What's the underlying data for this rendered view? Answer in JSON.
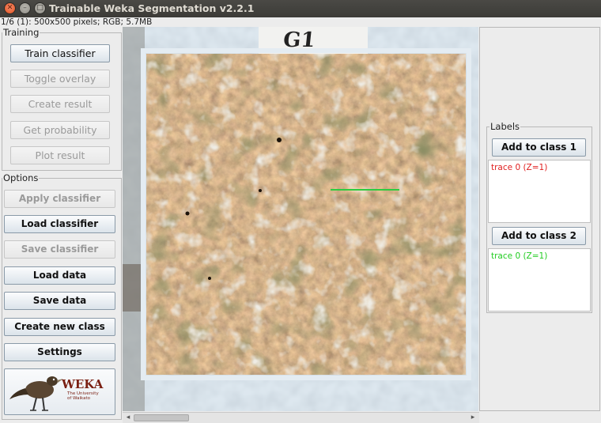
{
  "window": {
    "title": "Trainable Weka Segmentation v2.2.1",
    "subtitle": "1/6 (1): 500x500 pixels; RGB; 5.7MB"
  },
  "training": {
    "title": "Training",
    "buttons": [
      {
        "label": "Train classifier",
        "enabled": true
      },
      {
        "label": "Toggle overlay",
        "enabled": false
      },
      {
        "label": "Create result",
        "enabled": false
      },
      {
        "label": "Get probability",
        "enabled": false
      },
      {
        "label": "Plot result",
        "enabled": false
      }
    ]
  },
  "options": {
    "title": "Options",
    "buttons": [
      {
        "label": "Apply classifier",
        "enabled": false
      },
      {
        "label": "Load classifier",
        "enabled": true
      },
      {
        "label": "Save classifier",
        "enabled": false
      },
      {
        "label": "Load data",
        "enabled": true
      },
      {
        "label": "Save data",
        "enabled": true
      },
      {
        "label": "Create new class",
        "enabled": true
      },
      {
        "label": "Settings",
        "enabled": true
      }
    ]
  },
  "logo": {
    "name": "WEKA",
    "line1": "The University",
    "line2": "of Waikato"
  },
  "image": {
    "sample_label": "G1"
  },
  "labels": {
    "title": "Labels",
    "classes": [
      {
        "button": "Add to class 1",
        "traces": [
          "trace 0 (Z=1)"
        ],
        "color": "#e02020"
      },
      {
        "button": "Add to class 2",
        "traces": [
          "trace 0 (Z=1)"
        ],
        "color": "#22cc22"
      }
    ]
  },
  "colors": {
    "class1": "#e02020",
    "class2": "#22cc22",
    "trace_line": "#2ecc40"
  }
}
